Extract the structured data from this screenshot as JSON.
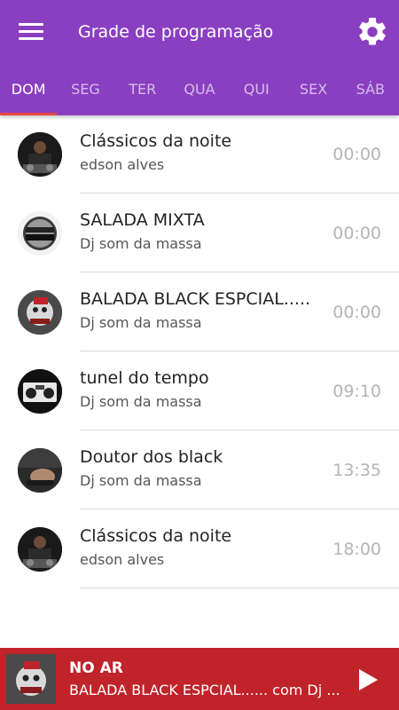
{
  "header": {
    "title": "Grade de programação",
    "menu_icon": "hamburger-menu-icon",
    "settings_icon": "gear-icon",
    "background": "#8a3fc1"
  },
  "days": {
    "selected": "DOM",
    "items": [
      "DOM",
      "SEG",
      "TER",
      "QUA",
      "QUI",
      "SEX",
      "SÁB"
    ],
    "indicator_color": "#e84545"
  },
  "schedule": [
    {
      "title": "Clássicos da noite",
      "host": "edson alves",
      "time": "00:00"
    },
    {
      "title": "SALADA MIXTA",
      "host": "Dj som da massa",
      "time": "00:00"
    },
    {
      "title": "BALADA BLACK ESPCIAL......",
      "host": "Dj som da massa",
      "time": "00:00"
    },
    {
      "title": "tunel do tempo",
      "host": "Dj som da massa",
      "time": "09:10"
    },
    {
      "title": "Doutor dos black",
      "host": "Dj som da massa",
      "time": "13:35"
    },
    {
      "title": "Clássicos da noite",
      "host": "edson alves",
      "time": "18:00"
    }
  ],
  "player": {
    "label": "NO AR",
    "track": "BALADA BLACK ESPCIAL...... com Dj ...",
    "play_icon": "play-icon",
    "background": "#c0232a"
  }
}
